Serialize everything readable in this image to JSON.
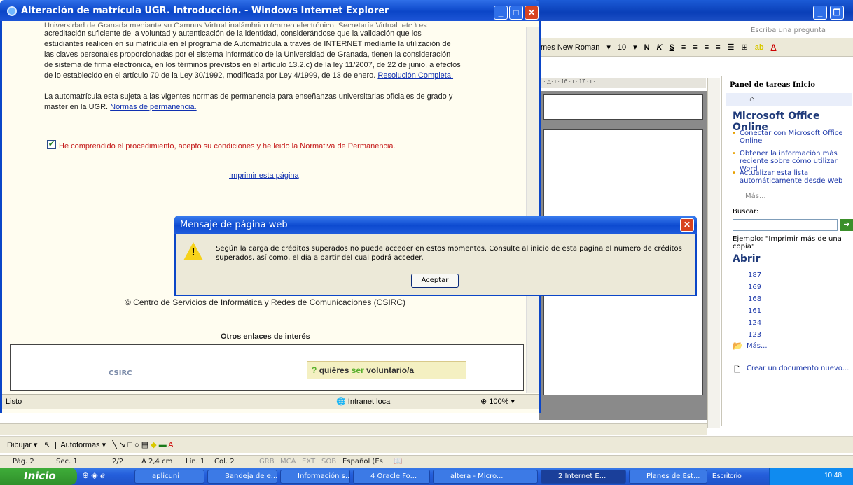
{
  "ie": {
    "title": "Alteración de matrícula UGR. Introducción. - Windows Internet Explorer",
    "paragraph1_line0": "Universidad de Granada mediante su Campus Virtual inalámbrico (correo electrónico, Secretaría Virtual, etc.) es",
    "paragraph1_line1": "acreditación suficiente de la voluntad y autenticación de la identidad, considerándose que la validación que los",
    "paragraph1_line2": "estudiantes realicen en su matrícula en el programa de Automatrícula a través de INTERNET mediante la utilización de",
    "paragraph1_line3": "las claves personales proporcionadas por el sistema informático de la Universidad de Granada, tienen la consideración",
    "paragraph1_line4": "de sistema de firma electrónica, en los términos previstos en el artículo 13.2.c) de la ley 11/2007, de 22 de junio, a efectos",
    "paragraph1_line5": "de lo establecido en el artículo 70 de la Ley 30/1992, modificada por Ley 4/1999, de 13 de enero.",
    "resolucion_link": "Resolución Completa.",
    "paragraph2_line1": "La automatrícula esta sujeta a las vigentes normas de permanencia para enseñanzas universitarias oficiales de grado y",
    "paragraph2_line2": "master en la UGR.",
    "normas_link": "Normas de permanencia.",
    "checkbox_label": "He comprendido el procedimiento, acepto su condiciones y he leido la Normativa de Permanencia.",
    "print_link": "Imprimir esta página",
    "copyright": "© Centro de Servicios de Informática y Redes de Comunicaciones (CSIRC)",
    "otros_enlaces": "Otros enlaces de interés",
    "csirc_logo": "CSIRC",
    "voluntario_a": "quiéres ",
    "voluntario_b": "ser",
    "voluntario_c": " voluntario/a",
    "status_text": "Listo",
    "status_zone": "Intranet local",
    "status_zoom": "100%"
  },
  "dialog": {
    "title": "Mensaje de página web",
    "message": "Según la carga de créditos superados no puede acceder en estos momentos. Consulte al inicio de esta pagina el numero de créditos superados, así como, el día a partir del cual podrá acceder.",
    "ok_label": "Aceptar"
  },
  "word": {
    "ask_placeholder": "Escriba una pregunta",
    "font_name": "mes New Roman",
    "font_size": "10",
    "bold": "N",
    "italic": "K",
    "underline": "S",
    "ruler": "· △· ı · 16 · ı · 17 · ı ·",
    "draw_label": "Dibujar",
    "autoshapes_label": "Autoformas",
    "status": {
      "page": "Pág. 2",
      "section": "Sec. 1",
      "pages": "2/2",
      "at": "A 2,4 cm",
      "line": "Lín. 1",
      "col": "Col. 2",
      "grb": "GRB",
      "mca": "MCA",
      "ext": "EXT",
      "sob": "SOB",
      "lang": "Español (Es"
    }
  },
  "task_pane": {
    "title": "Panel de tareas Inicio",
    "office_heading": "Microsoft Office Online",
    "bullets": [
      "Conectar con Microsoft Office Online",
      "Obtener la información más reciente sobre cómo utilizar Word",
      "Actualizar esta lista automáticamente desde Web"
    ],
    "more1": "Más...",
    "search_label": "Buscar:",
    "example": "Ejemplo: \"Imprimir más de una copia\"",
    "open_heading": "Abrir",
    "recent_files": [
      "187",
      "169",
      "168",
      "161",
      "124",
      "123"
    ],
    "more2": "Más...",
    "new_doc": "Crear un documento nuevo..."
  },
  "taskbar": {
    "start": "Inicio",
    "items": [
      "aplicuni",
      "Bandeja de e...",
      "Información s...",
      "4 Oracle Fo...",
      "altera - Micro...",
      "2 Internet E...",
      "Planes de Est..."
    ],
    "escritorio": "Escritorio",
    "clock": "10:48"
  }
}
